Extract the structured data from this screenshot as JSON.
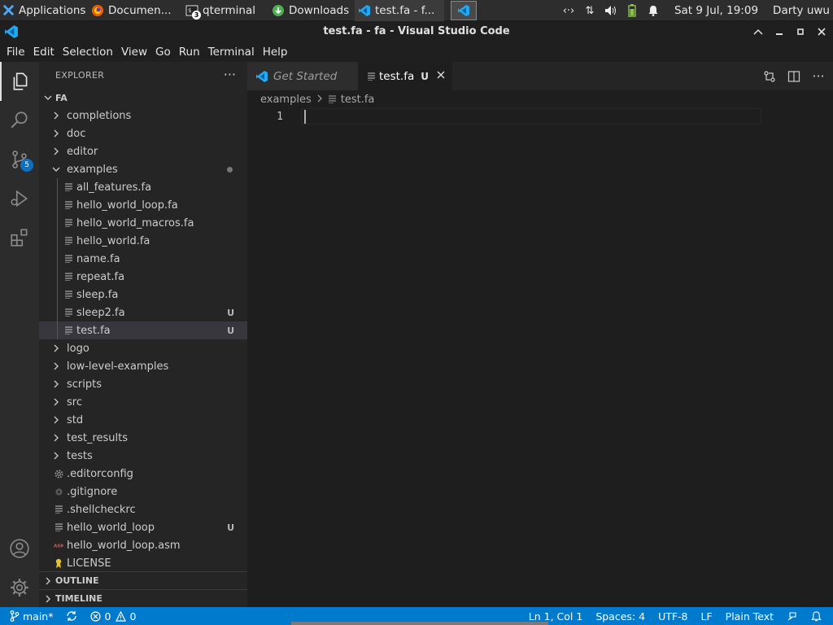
{
  "taskbar": {
    "apps_label": "Applications",
    "tasks": [
      {
        "label": "Documen...",
        "icon": "firefox-icon"
      },
      {
        "label": "qterminal",
        "icon": "terminal-icon",
        "badge": "3"
      },
      {
        "label": "Downloads",
        "icon": "download-icon"
      },
      {
        "label": "test.fa - f...",
        "icon": "vscode-icon"
      }
    ],
    "clock": "Sat  9 Jul, 19:09",
    "user": "Darty uwu",
    "tray_icons": [
      "network-arrows-icon",
      "updown-arrows-icon",
      "volume-icon",
      "battery-icon",
      "bell-icon"
    ]
  },
  "window": {
    "title": "test.fa - fa - Visual Studio Code"
  },
  "menu": [
    "File",
    "Edit",
    "Selection",
    "View",
    "Go",
    "Run",
    "Terminal",
    "Help"
  ],
  "activity": {
    "source_control_badge": "5"
  },
  "sidebar": {
    "header": "EXPLORER",
    "more": "···",
    "root": "FA",
    "items": [
      {
        "label": "completions",
        "kind": "folder",
        "expanded": false,
        "depth": 1
      },
      {
        "label": "doc",
        "kind": "folder",
        "expanded": false,
        "depth": 1
      },
      {
        "label": "editor",
        "kind": "folder",
        "expanded": false,
        "depth": 1
      },
      {
        "label": "examples",
        "kind": "folder",
        "expanded": true,
        "depth": 1,
        "modified_dot": true
      },
      {
        "label": "all_features.fa",
        "kind": "file",
        "depth": 2
      },
      {
        "label": "hello_world_loop.fa",
        "kind": "file",
        "depth": 2
      },
      {
        "label": "hello_world_macros.fa",
        "kind": "file",
        "depth": 2
      },
      {
        "label": "hello_world.fa",
        "kind": "file",
        "depth": 2
      },
      {
        "label": "name.fa",
        "kind": "file",
        "depth": 2
      },
      {
        "label": "repeat.fa",
        "kind": "file",
        "depth": 2
      },
      {
        "label": "sleep.fa",
        "kind": "file",
        "depth": 2
      },
      {
        "label": "sleep2.fa",
        "kind": "file",
        "depth": 2,
        "git": "U"
      },
      {
        "label": "test.fa",
        "kind": "file",
        "depth": 2,
        "git": "U",
        "selected": true
      },
      {
        "label": "logo",
        "kind": "folder",
        "expanded": false,
        "depth": 1
      },
      {
        "label": "low-level-examples",
        "kind": "folder",
        "expanded": false,
        "depth": 1
      },
      {
        "label": "scripts",
        "kind": "folder",
        "expanded": false,
        "depth": 1
      },
      {
        "label": "src",
        "kind": "folder",
        "expanded": false,
        "depth": 1
      },
      {
        "label": "std",
        "kind": "folder",
        "expanded": false,
        "depth": 1
      },
      {
        "label": "test_results",
        "kind": "folder",
        "expanded": false,
        "depth": 1
      },
      {
        "label": "tests",
        "kind": "folder",
        "expanded": false,
        "depth": 1
      },
      {
        "label": ".editorconfig",
        "kind": "file",
        "icon": "gear-file-icon",
        "depth": 1
      },
      {
        "label": ".gitignore",
        "kind": "file",
        "icon": "git-file-icon",
        "depth": 1
      },
      {
        "label": ".shellcheckrc",
        "kind": "file",
        "depth": 1
      },
      {
        "label": "hello_world_loop",
        "kind": "file",
        "depth": 1,
        "git": "U"
      },
      {
        "label": "hello_world_loop.asm",
        "kind": "file",
        "icon": "asm-file-icon",
        "depth": 1
      },
      {
        "label": "LICENSE",
        "kind": "file",
        "icon": "license-icon",
        "depth": 1
      }
    ],
    "outline": "OUTLINE",
    "timeline": "TIMELINE"
  },
  "editor": {
    "tabs": [
      {
        "label": "Get Started",
        "active": false
      },
      {
        "label": "test.fa",
        "active": true,
        "git": "U"
      }
    ],
    "breadcrumb": [
      "examples",
      "test.fa"
    ],
    "line_number": "1"
  },
  "statusbar": {
    "branch": "main*",
    "errors": "0",
    "warnings": "0",
    "position": "Ln 1, Col 1",
    "spaces": "Spaces: 4",
    "encoding": "UTF-8",
    "eol": "LF",
    "language": "Plain Text"
  },
  "colors": {
    "statusbar": "#007acc",
    "activitybar": "#2c2c2c",
    "sidebar": "#252526",
    "editor": "#1e1e1e",
    "badge": "#0e70c0"
  }
}
